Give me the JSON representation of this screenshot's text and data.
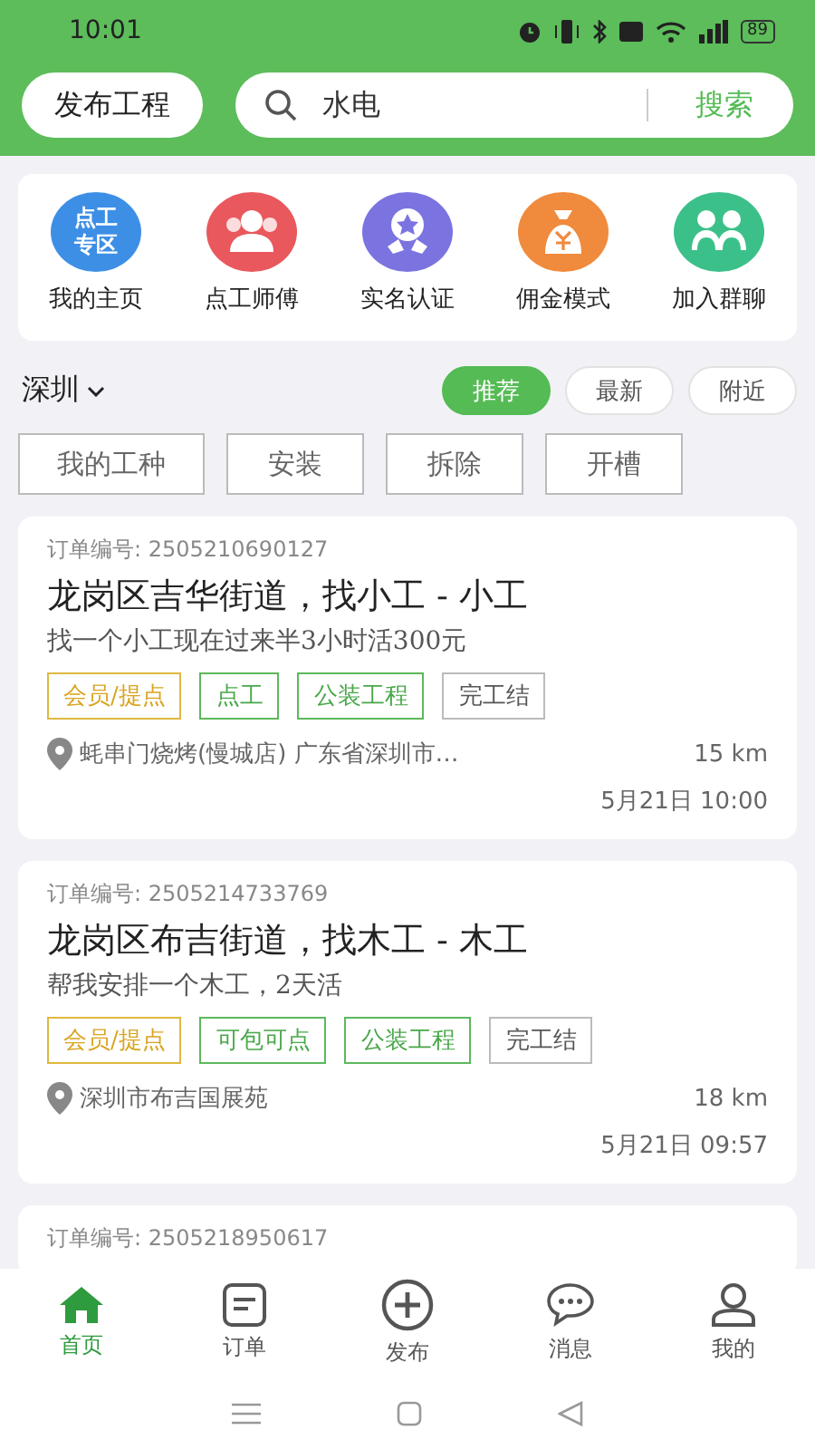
{
  "status_bar": {
    "time": "10:01",
    "battery": "89"
  },
  "header": {
    "publish_button": "发布工程",
    "search": {
      "value": "水电",
      "button": "搜索"
    }
  },
  "quick_menu": [
    {
      "kind": "badge",
      "badge_lines": [
        "点工",
        "专区"
      ],
      "label": "我的主页"
    },
    {
      "kind": "people",
      "label": "点工师傅"
    },
    {
      "kind": "medal",
      "label": "实名认证"
    },
    {
      "kind": "moneybag",
      "label": "佣金模式"
    },
    {
      "kind": "group",
      "label": "加入群聊"
    }
  ],
  "city": "深圳",
  "sort_tabs": [
    {
      "label": "推荐",
      "selected": true
    },
    {
      "label": "最新",
      "selected": false
    },
    {
      "label": "附近",
      "selected": false
    }
  ],
  "categories": [
    "我的工种",
    "安装",
    "拆除",
    "开槽"
  ],
  "orders": [
    {
      "order_no": "订单编号: 2505210690127",
      "title": "龙岗区吉华街道，找小工 - 小工",
      "desc": "找一个小工现在过来半3小时活300元",
      "tags": [
        {
          "kind": "member",
          "label": "会员/提点"
        },
        {
          "kind": "green",
          "label": "点工"
        },
        {
          "kind": "green",
          "label": "公装工程"
        },
        {
          "kind": "plain",
          "label": "完工结"
        }
      ],
      "address": "蚝串门烧烤(慢城店) 广东省深圳市…",
      "distance": "15 km",
      "time": "5月21日  10:00"
    },
    {
      "order_no": "订单编号: 2505214733769",
      "title": "龙岗区布吉街道，找木工 - 木工",
      "desc": "帮我安排一个木工，2天活",
      "tags": [
        {
          "kind": "member",
          "label": "会员/提点"
        },
        {
          "kind": "green",
          "label": "可包可点"
        },
        {
          "kind": "green",
          "label": "公装工程"
        },
        {
          "kind": "plain",
          "label": "完工结"
        }
      ],
      "address": "深圳市布吉国展苑",
      "distance": "18 km",
      "time": "5月21日  09:57"
    },
    {
      "order_no": "订单编号: 2505218950617"
    }
  ],
  "tab_bar": [
    {
      "kind": "home",
      "label": "首页",
      "selected": true
    },
    {
      "kind": "orders",
      "label": "订单",
      "selected": false
    },
    {
      "kind": "publish",
      "label": "发布",
      "selected": false
    },
    {
      "kind": "messages",
      "label": "消息",
      "selected": false
    },
    {
      "kind": "profile",
      "label": "我的",
      "selected": false
    }
  ]
}
